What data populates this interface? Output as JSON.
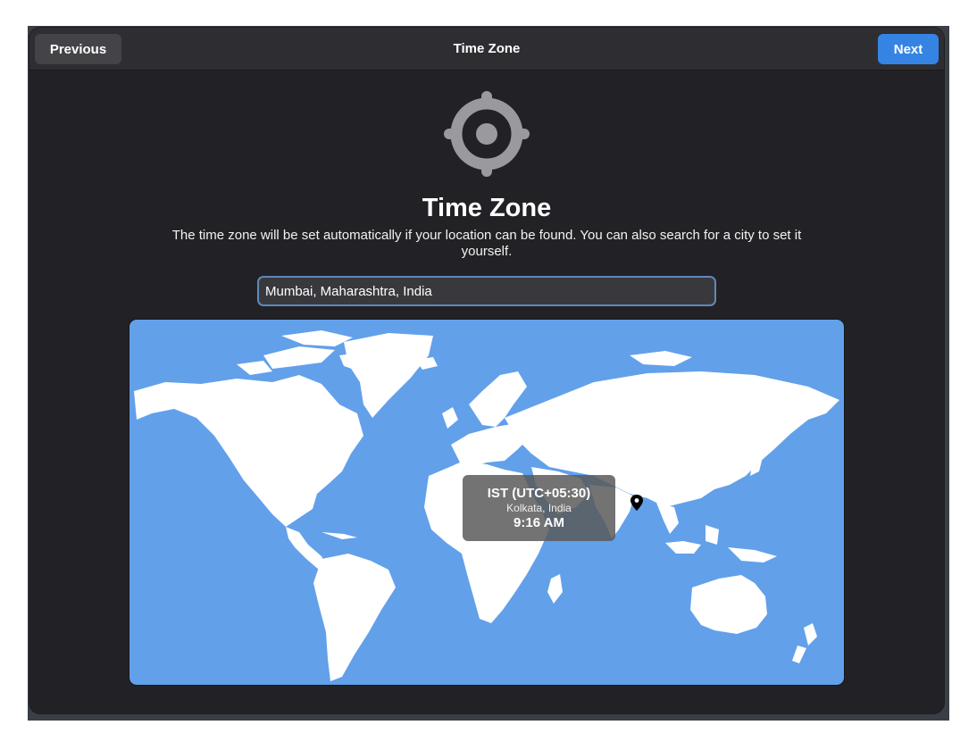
{
  "header": {
    "previous_label": "Previous",
    "title": "Time Zone",
    "next_label": "Next"
  },
  "page": {
    "icon": "location-crosshair-icon",
    "title": "Time Zone",
    "description": "The time zone will be set automatically if your location can be found. You can also search for a city to set it yourself."
  },
  "search": {
    "value": "Mumbai, Maharashtra, India"
  },
  "map": {
    "marker_icon": "map-pin-icon",
    "tooltip": {
      "zone": "IST (UTC+05:30)",
      "city": "Kolkata, India",
      "time": "9:16 AM"
    }
  },
  "colors": {
    "accent": "#3584e4",
    "ocean": "#62a0ea",
    "land": "#ffffff",
    "window_bg": "#222226"
  }
}
